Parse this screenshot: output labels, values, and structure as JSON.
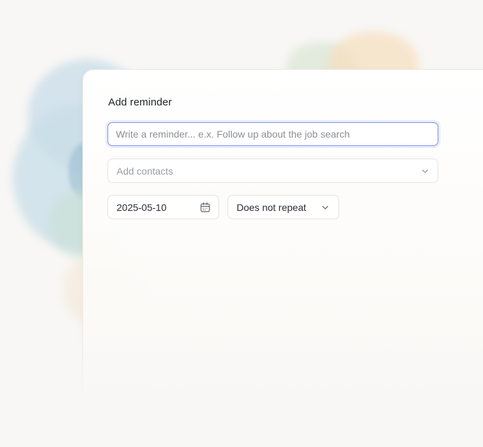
{
  "dialog": {
    "title": "Add reminder"
  },
  "reminder": {
    "value": "",
    "placeholder": "Write a reminder... e.x. Follow up about the job search"
  },
  "contacts": {
    "placeholder": "Add contacts",
    "icon": "chevron-down-icon"
  },
  "date": {
    "value": "2025-05-10",
    "icon": "calendar-icon"
  },
  "repeat": {
    "value": "Does not repeat",
    "icon": "chevron-down-icon"
  },
  "colors": {
    "focus_border": "#7f93e8",
    "text": "#2a2d33",
    "placeholder": "#9a9ca1"
  }
}
